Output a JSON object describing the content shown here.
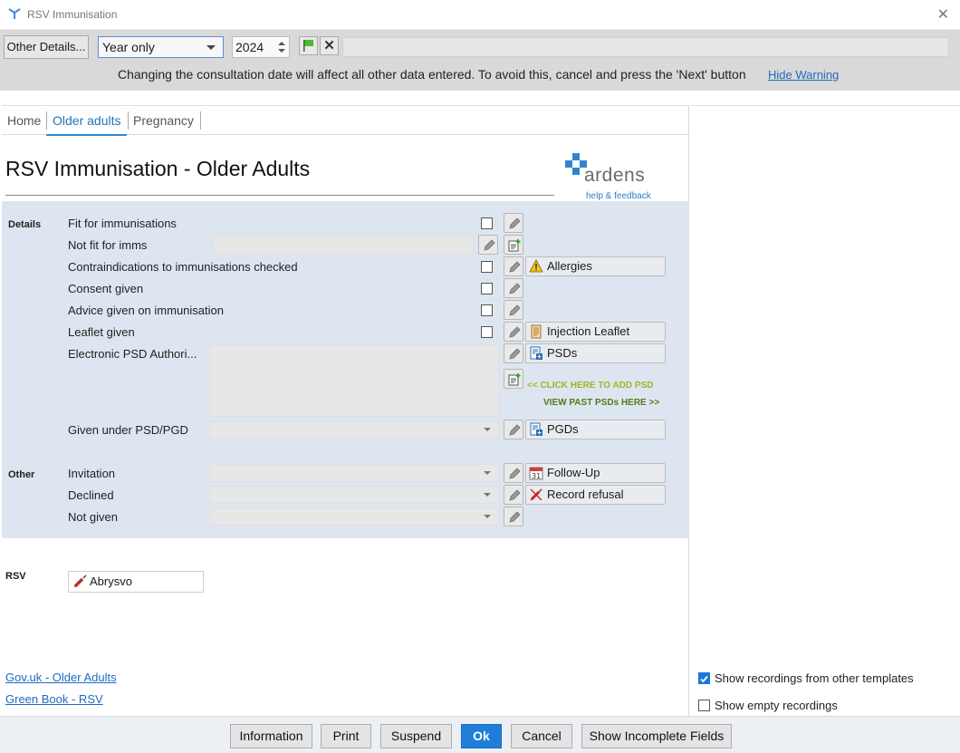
{
  "window": {
    "title": "RSV Immunisation"
  },
  "toolbar": {
    "other_details_label": "Other Details...",
    "period_value": "Year only",
    "year_value": "2024",
    "warning_text": "Changing the consultation date will affect all other data entered. To avoid this, cancel and press the 'Next' button",
    "hide_warning_label": "Hide Warning"
  },
  "tabs": [
    {
      "label": "Home",
      "active": false
    },
    {
      "label": "Older adults",
      "active": true
    },
    {
      "label": "Pregnancy",
      "active": false
    }
  ],
  "page": {
    "title": "RSV Immunisation - Older Adults",
    "logo_text": "ardens",
    "logo_help": "help & feedback"
  },
  "details": {
    "section_label": "Details",
    "rows": [
      {
        "label": "Fit for immunisations"
      },
      {
        "label": "Not fit for imms"
      },
      {
        "label": "Contraindications to immunisations checked"
      },
      {
        "label": "Consent given"
      },
      {
        "label": "Advice given on immunisation"
      },
      {
        "label": "Leaflet given"
      },
      {
        "label": "Electronic PSD Authori..."
      },
      {
        "label": "Given under PSD/PGD"
      }
    ],
    "buttons": {
      "allergies": "Allergies",
      "injection_leaflet": "Injection Leaflet",
      "psds": "PSDs",
      "pgds": "PGDs"
    },
    "add_psd_link": "<< CLICK HERE TO ADD PSD",
    "view_psd_link": "VIEW PAST PSDs HERE >>"
  },
  "other": {
    "section_label": "Other",
    "rows": [
      {
        "label": "Invitation"
      },
      {
        "label": "Declined"
      },
      {
        "label": "Not given"
      }
    ],
    "buttons": {
      "follow_up": "Follow-Up",
      "record_refusal": "Record refusal"
    }
  },
  "rsv": {
    "section_label": "RSV",
    "vaccine": "Abrysvo"
  },
  "links": [
    "Gov.uk - Older Adults",
    "Green Book - RSV"
  ],
  "options": {
    "show_other_templates": {
      "label": "Show recordings from other templates",
      "checked": true
    },
    "show_empty": {
      "label": "Show empty recordings",
      "checked": false
    }
  },
  "footer": {
    "information": "Information",
    "print": "Print",
    "suspend": "Suspend",
    "ok": "Ok",
    "cancel": "Cancel",
    "show_incomplete": "Show Incomplete Fields"
  },
  "colors": {
    "accent": "#1f7fd8",
    "panel": "#dde6f0",
    "link": "#1f6bbf",
    "add_psd": "#a1b429",
    "view_psd": "#55781c"
  }
}
